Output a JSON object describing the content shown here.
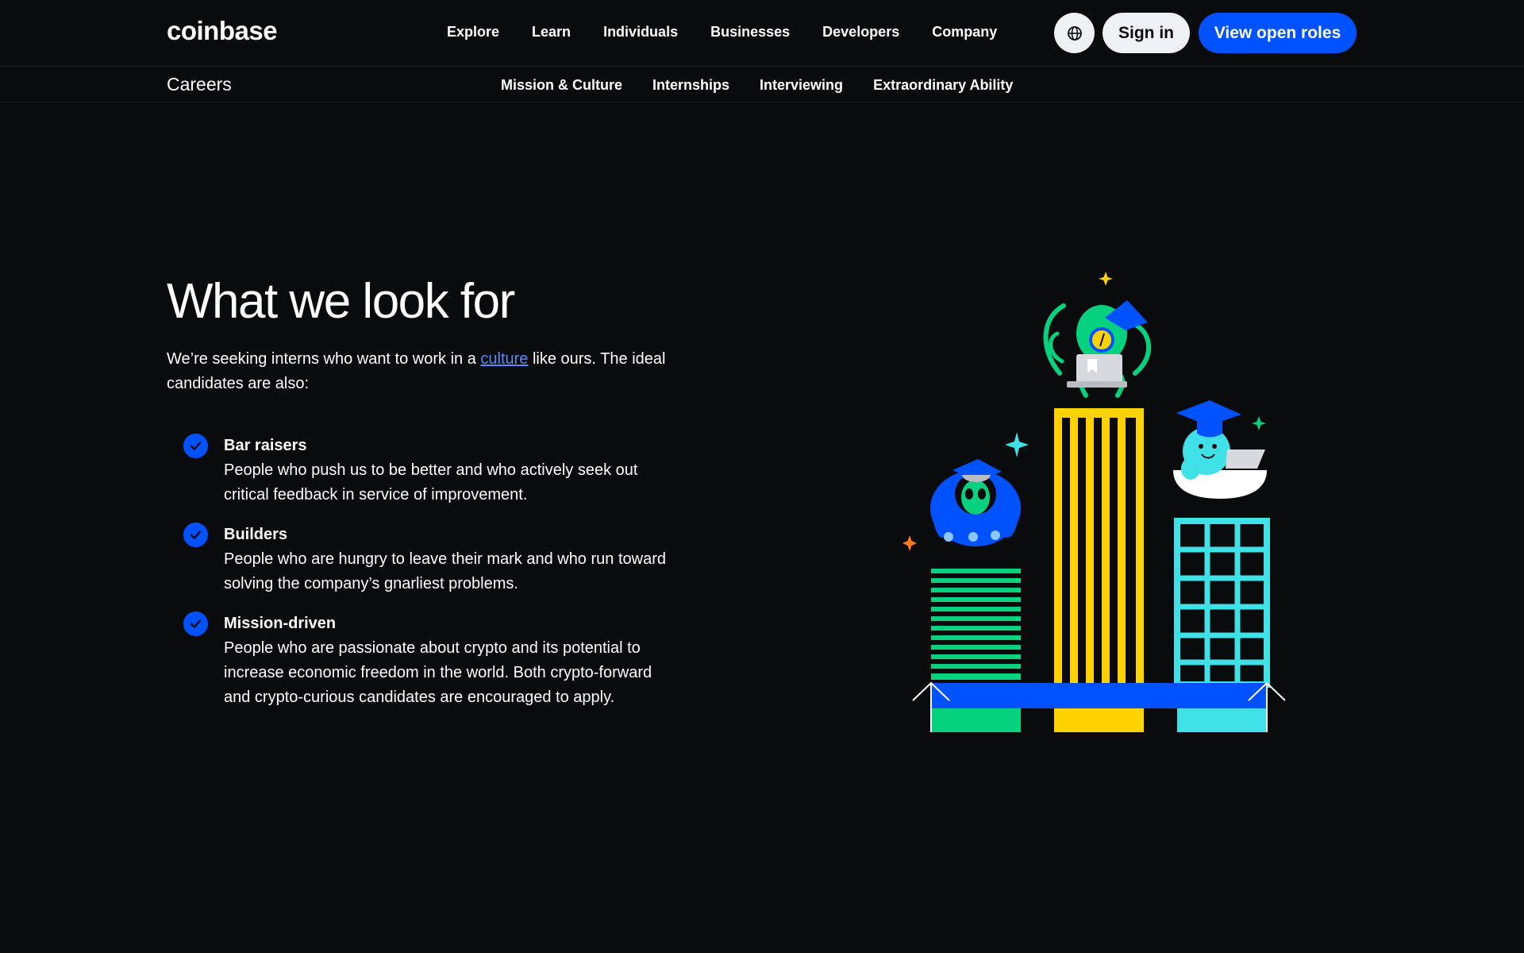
{
  "brand": {
    "logo_text": "coinbase"
  },
  "nav": {
    "items": [
      {
        "label": "Explore"
      },
      {
        "label": "Learn"
      },
      {
        "label": "Individuals"
      },
      {
        "label": "Businesses"
      },
      {
        "label": "Developers"
      },
      {
        "label": "Company"
      }
    ],
    "globe_icon": "globe-icon",
    "signin_label": "Sign in",
    "roles_label": "View open roles"
  },
  "subnav": {
    "title": "Careers",
    "items": [
      {
        "label": "Mission & Culture"
      },
      {
        "label": "Internships"
      },
      {
        "label": "Interviewing"
      },
      {
        "label": "Extraordinary Ability"
      }
    ]
  },
  "main": {
    "heading": "What we look for",
    "intro_before": "We’re seeking interns who want to work in a ",
    "intro_link": "culture",
    "intro_after": " like ours. The ideal candidates are also:",
    "qualities": [
      {
        "title": "Bar raisers",
        "text": "People who push us to be better and who actively seek out critical feedback in service of improvement."
      },
      {
        "title": "Builders",
        "text": "People who are hungry to leave their mark and who run toward solving the company’s gnarliest problems."
      },
      {
        "title": "Mission-driven",
        "text": "People who are passionate about crypto and its potential to increase economic freedom in the world. Both crypto-forward and crypto-curious candidates are encouraged to apply."
      }
    ]
  },
  "colors": {
    "background": "#0a0b0d",
    "accent_blue": "#0052ff",
    "link_blue": "#578bfa",
    "green": "#05d17f",
    "yellow": "#ffd200",
    "cyan": "#3fe0e6"
  }
}
